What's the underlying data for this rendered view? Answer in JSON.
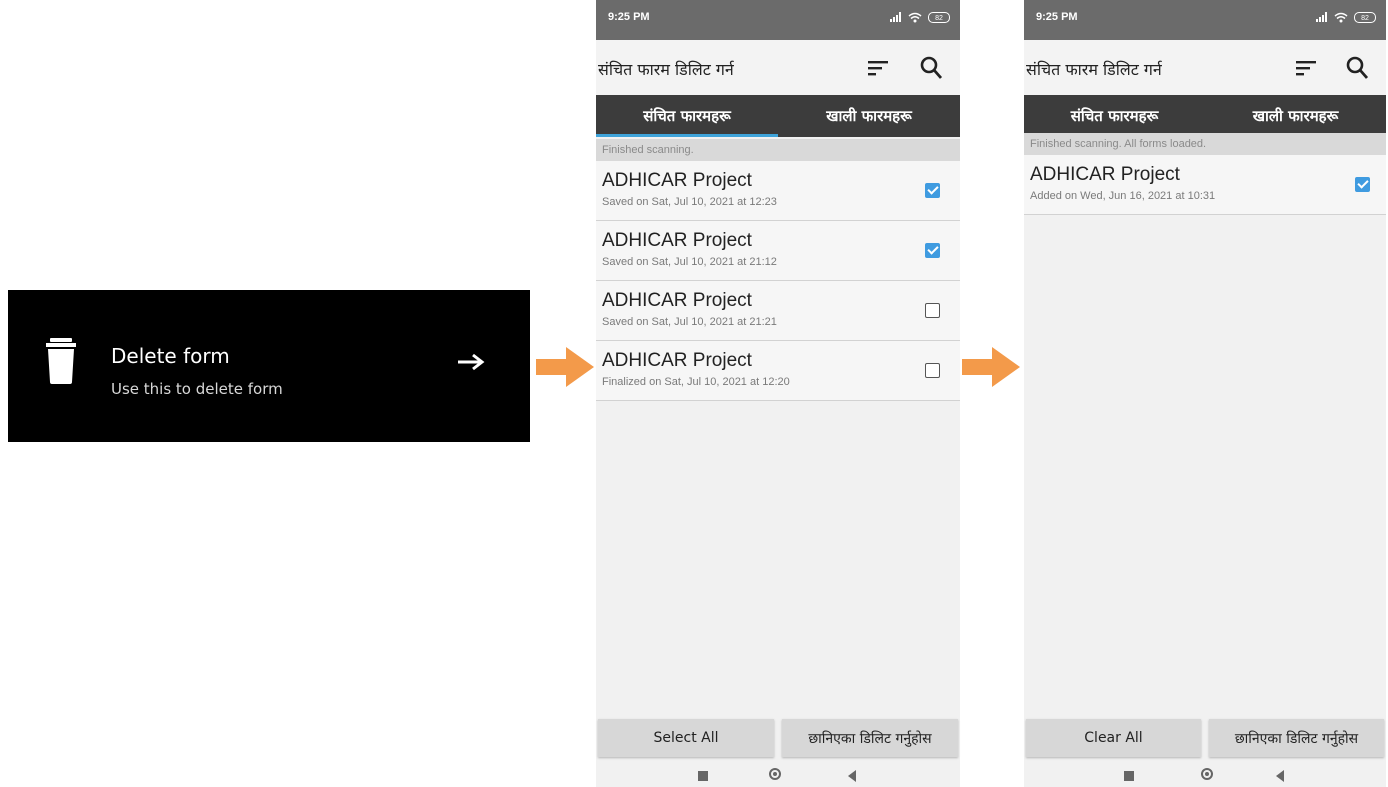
{
  "menu_card": {
    "title": "Delete form",
    "subtitle": "Use this to delete form",
    "icon": "trash-icon",
    "arrow_icon": "right-arrow-icon"
  },
  "colors": {
    "accent_orange": "#f39a4a",
    "tab_indicator": "#3ea3d9",
    "checkbox_checked": "#3f9be0",
    "tab_bar": "#3c3c3c",
    "status_bar": "#6b6b6b"
  },
  "screen1": {
    "status": {
      "time": "9:25 PM",
      "battery": "82"
    },
    "app_title": "संचित फारम डिलिट गर्न",
    "tabs": [
      {
        "label": "संचित फारमहरू",
        "active": true
      },
      {
        "label": "खाली फारमहरू",
        "active": false
      }
    ],
    "notice": "Finished scanning.",
    "rows": [
      {
        "name": "ADHICAR Project",
        "meta": "Saved on Sat, Jul 10, 2021 at 12:23",
        "checked": true
      },
      {
        "name": "ADHICAR Project",
        "meta": "Saved on Sat, Jul 10, 2021 at 21:12",
        "checked": true
      },
      {
        "name": "ADHICAR Project",
        "meta": "Saved on Sat, Jul 10, 2021 at 21:21",
        "checked": false
      },
      {
        "name": "ADHICAR Project",
        "meta": "Finalized on Sat, Jul 10, 2021 at 12:20",
        "checked": false
      }
    ],
    "buttons": {
      "left": "Select All",
      "right": "छानिएका डिलिट गर्नुहोस"
    }
  },
  "screen2": {
    "status": {
      "time": "9:25 PM",
      "battery": "82"
    },
    "app_title": "संचित फारम डिलिट गर्न",
    "tabs": [
      {
        "label": "संचित फारमहरू",
        "active": false
      },
      {
        "label": "खाली फारमहरू",
        "active": true
      }
    ],
    "notice": "Finished scanning. All forms loaded.",
    "rows": [
      {
        "name": "ADHICAR Project",
        "meta": "Added on Wed, Jun 16, 2021 at 10:31",
        "checked": true
      }
    ],
    "buttons": {
      "left": "Clear All",
      "right": "छानिएका डिलिट गर्नुहोस"
    }
  }
}
